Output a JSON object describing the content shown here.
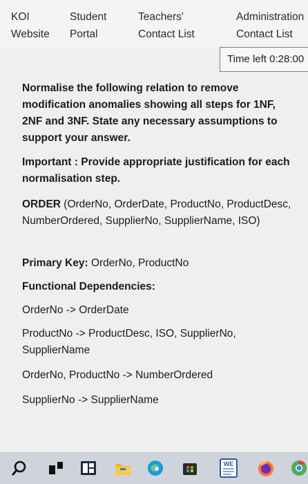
{
  "nav": {
    "koi": [
      "KOI",
      "Website"
    ],
    "student": [
      "Student",
      "Portal"
    ],
    "teachers": [
      "Teachers'",
      "Contact List"
    ],
    "admin": [
      "Administration",
      "Contact List"
    ]
  },
  "timer": {
    "label": "Time left 0:28:00"
  },
  "question": {
    "instruction": "Normalise the following relation to remove modification anomalies showing all steps for 1NF, 2NF and 3NF. State any necessary assumptions to support your answer.",
    "important_label": "Important :",
    "important_text": " Provide appropriate justification for each normalisation step.",
    "relation_name": "ORDER",
    "relation_attrs": " (OrderNo, OrderDate, ProductNo, ProductDesc, NumberOrdered, SupplierNo, SupplierName, ISO)",
    "pk_label": "Primary Key:",
    "pk_value": " OrderNo, ProductNo",
    "fd_heading": "Functional Dependencies:",
    "fd1": "OrderNo -> OrderDate",
    "fd2": "ProductNo -> ProductDesc, ISO, SupplierNo, SupplierName",
    "fd3": "OrderNo, ProductNo -> NumberOrdered",
    "fd4": "SupplierNo -> SupplierName"
  },
  "taskbar": {
    "icons": [
      "search-icon",
      "task-view-icon",
      "widgets-icon",
      "file-explorer-icon",
      "edge-icon",
      "store-icon",
      "word-icon",
      "firefox-icon",
      "chrome-icon"
    ],
    "word_badge": "WE"
  }
}
